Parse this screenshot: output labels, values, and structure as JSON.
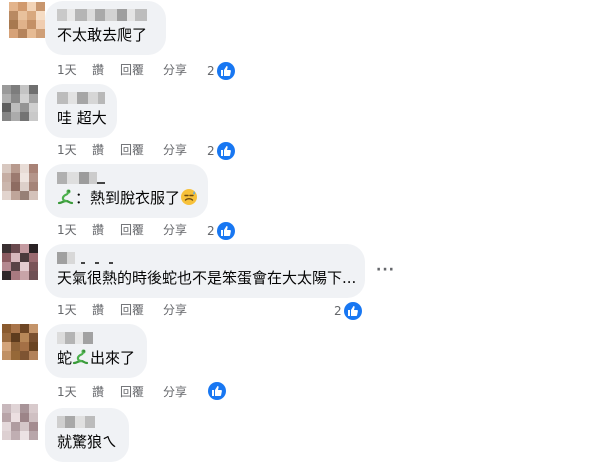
{
  "comments": [
    {
      "text": "不太敢去爬了",
      "actions": {
        "time": "1天",
        "like": "讚",
        "reply": "回覆",
        "share": "分享"
      },
      "reaction_count": "2",
      "avatar_colors": [
        "#e3b48c",
        "#d19a6e",
        "#f2d3b6",
        "#c8966e",
        "#b98a62",
        "#e8c19c",
        "#d8a87e",
        "#f5dcc4",
        "#a8794f",
        "#e0b28a",
        "#c49066",
        "#f0cdb0",
        "#d6a278",
        "#b5845c",
        "#e6bb94",
        "#cf9f77"
      ]
    },
    {
      "text": "哇 超大",
      "actions": {
        "time": "1天",
        "like": "讚",
        "reply": "回覆",
        "share": "分享"
      },
      "reaction_count": "2",
      "avatar_colors": [
        "#9a9a9a",
        "#7d7d7d",
        "#c4c4c4",
        "#6f6f6f",
        "#b0b0b0",
        "#8a8a8a",
        "#d2d2d2",
        "#a3a3a3",
        "#5e5e5e",
        "#bdbdbd",
        "#949494",
        "#cfcfcf",
        "#858585",
        "#ababab",
        "#737373",
        "#c9c9c9"
      ]
    },
    {
      "text": "：熱到脫衣服了",
      "actions": {
        "time": "1天",
        "like": "讚",
        "reply": "回覆",
        "share": "分享"
      },
      "reaction_count": "2",
      "avatar_colors": [
        "#d8c8c0",
        "#b89a8e",
        "#e8dcd6",
        "#a88276",
        "#c6aea4",
        "#9c7a70",
        "#efe5e0",
        "#b4958a",
        "#cbb6ad",
        "#8e6c62",
        "#ddd0ca",
        "#a58478",
        "#e2d4ce",
        "#bfa59a",
        "#978076",
        "#d4c2ba"
      ]
    },
    {
      "text": "天氣很熱的時後蛇也不是笨蛋會在大太陽下...",
      "actions": {
        "time": "1天",
        "like": "讚",
        "reply": "回覆",
        "share": "分享"
      },
      "reaction_count": "2",
      "more_label": "···",
      "avatar_colors": [
        "#3a3032",
        "#6a4a4e",
        "#c49aa0",
        "#2a2224",
        "#8a5a60",
        "#d8b8bc",
        "#4a3a3c",
        "#9a6a70",
        "#b48890",
        "#5a4446",
        "#e4ccd0",
        "#7a5458",
        "#2e2628",
        "#a87a80",
        "#c8a4a8",
        "#6e5054"
      ]
    },
    {
      "text_before": "蛇",
      "text_after": "出來了",
      "actions": {
        "time": "1天",
        "like": "讚",
        "reply": "回覆",
        "share": "分享"
      },
      "reaction_count": "",
      "avatar_colors": [
        "#8a5a2e",
        "#a8744a",
        "#6e4624",
        "#c4946a",
        "#9a6a3e",
        "#5e3c1e",
        "#b88858",
        "#7a5030",
        "#d4a47a",
        "#8e6238",
        "#a47046",
        "#6a4422",
        "#c09064",
        "#966838",
        "#7e5432",
        "#b2825a"
      ]
    },
    {
      "text": "就驚狼ㄟ",
      "actions": {},
      "reaction_count": "",
      "avatar_colors": [
        "#c8b8bc",
        "#e0d4d6",
        "#a89498",
        "#d8cacc",
        "#b8a4a8",
        "#ecdfe1",
        "#9c8488",
        "#cfc0c2",
        "#e4d8da",
        "#b09ca0",
        "#d4c6c8",
        "#a48c90",
        "#ddd0d2",
        "#c0aeb2",
        "#ece2e4",
        "#b8a6aa"
      ]
    }
  ],
  "accent_color": "#1877f2"
}
